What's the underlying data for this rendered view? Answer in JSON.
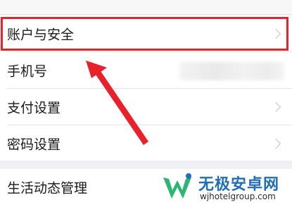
{
  "settings": {
    "group1": [
      {
        "label": "账户与安全",
        "chevron": true
      },
      {
        "label": "手机号",
        "chevron": false
      },
      {
        "label": "支付设置",
        "chevron": true
      },
      {
        "label": "密码设置",
        "chevron": true
      }
    ],
    "group2": [
      {
        "label": "生活动态管理",
        "chevron": false
      }
    ]
  },
  "annotation": {
    "highlight_color": "#e8212b",
    "arrow_color": "#e8212b"
  },
  "watermark": {
    "title": "无极安卓网",
    "url": "wjhotelgroup.com",
    "logo_color": "#2bb673"
  },
  "colors": {
    "background": "#efeff4",
    "row": "#ffffff",
    "text": "#1a1a1a",
    "chevron": "#c2c2c2"
  }
}
